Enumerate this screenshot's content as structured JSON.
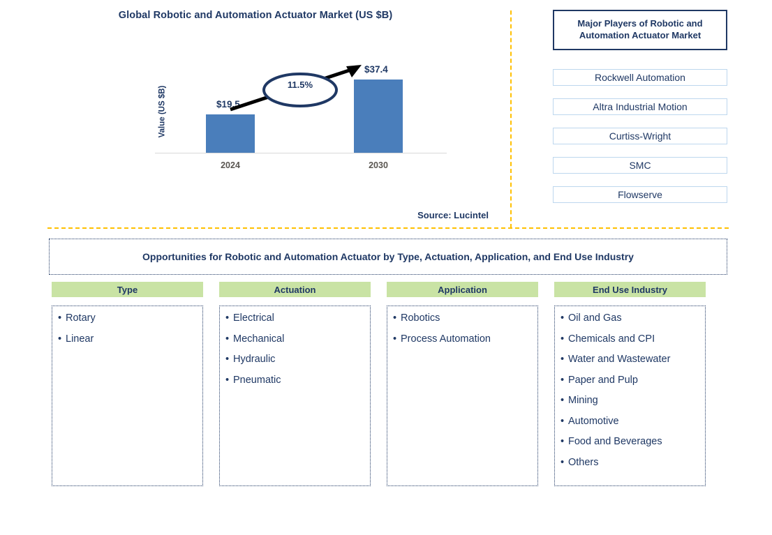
{
  "chart_panel": {
    "title": "Global Robotic and Automation Actuator Market (US $B)",
    "y_axis_label": "Value (US $B)",
    "cagr_label": "11.5%",
    "source": "Source: Lucintel"
  },
  "chart_data": {
    "type": "bar",
    "title": "Global Robotic and Automation Actuator Market (US $B)",
    "categories": [
      "2024",
      "2030"
    ],
    "values": [
      19.5,
      37.4
    ],
    "value_labels": [
      "$19.5",
      "$37.4"
    ],
    "xlabel": "",
    "ylabel": "Value (US $B)",
    "ylim": [
      0,
      40
    ],
    "grid": false,
    "legend": "none",
    "annotation": "11.5%",
    "annotation_meaning": "CAGR 2024-2030",
    "bar_color": "#4a7ebb",
    "source": "Source: Lucintel"
  },
  "players_panel": {
    "title": "Major Players of Robotic and Automation Actuator Market",
    "items": [
      "Rockwell Automation",
      "Altra Industrial Motion",
      "Curtiss-Wright",
      "SMC",
      "Flowserve"
    ]
  },
  "opportunities": {
    "banner": "Opportunities for Robotic and Automation Actuator by Type, Actuation, Application, and End Use Industry",
    "columns": [
      {
        "header": "Type",
        "items": [
          "Rotary",
          "Linear"
        ]
      },
      {
        "header": "Actuation",
        "items": [
          "Electrical",
          "Mechanical",
          "Hydraulic",
          "Pneumatic"
        ]
      },
      {
        "header": "Application",
        "items": [
          "Robotics",
          "Process Automation"
        ]
      },
      {
        "header": "End Use Industry",
        "items": [
          "Oil and Gas",
          "Chemicals and CPI",
          "Water and Wastewater",
          "Paper and Pulp",
          "Mining",
          "Automotive",
          "Food and Beverages",
          "Others"
        ]
      }
    ]
  },
  "colors": {
    "navy": "#1f3864",
    "bar_blue": "#4a7ebb",
    "header_green": "#c9e3a4",
    "divider_orange": "#ffc000",
    "player_border": "#bdd7ee"
  }
}
